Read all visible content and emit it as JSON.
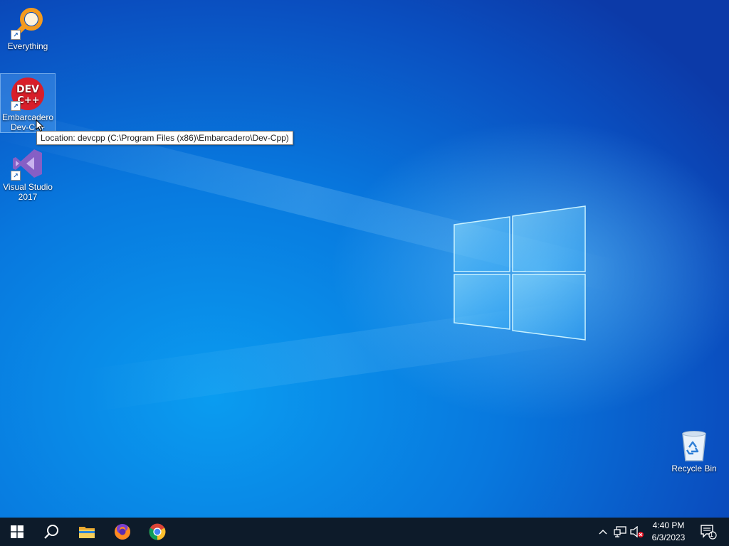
{
  "desktop": {
    "icons": [
      {
        "label": "Everything",
        "icon": "magnifier-orange-icon"
      },
      {
        "label": "Embarcadero Dev-C++",
        "label_line1": "Embarcadero",
        "label_line2": "Dev-C++",
        "icon": "devcpp-icon",
        "badge_top": "DEV",
        "badge_bottom": "C++"
      },
      {
        "label": "Visual Studio 2017",
        "label_line1": "Visual Studio",
        "label_line2": "2017",
        "icon": "visual-studio-icon"
      },
      {
        "label": "Recycle Bin",
        "icon": "recycle-bin-icon"
      }
    ],
    "tooltip": "Location: devcpp (C:\\Program Files (x86)\\Embarcadero\\Dev-Cpp)"
  },
  "taskbar": {
    "pinned": [
      {
        "name": "start",
        "icon": "windows-start-icon"
      },
      {
        "name": "search",
        "icon": "search-icon"
      },
      {
        "name": "file-explorer",
        "icon": "folder-icon"
      },
      {
        "name": "firefox",
        "icon": "firefox-icon"
      },
      {
        "name": "chrome",
        "icon": "chrome-icon"
      }
    ],
    "tray": {
      "time": "4:40 PM",
      "date": "6/3/2023",
      "notification_count": "1"
    }
  },
  "colors": {
    "desktop_blue": "#0878de",
    "taskbar": "#0d1b2a",
    "devcpp_red": "#d81e2a",
    "vs_purple": "#865fc5",
    "everything_orange": "#f39a1e"
  }
}
